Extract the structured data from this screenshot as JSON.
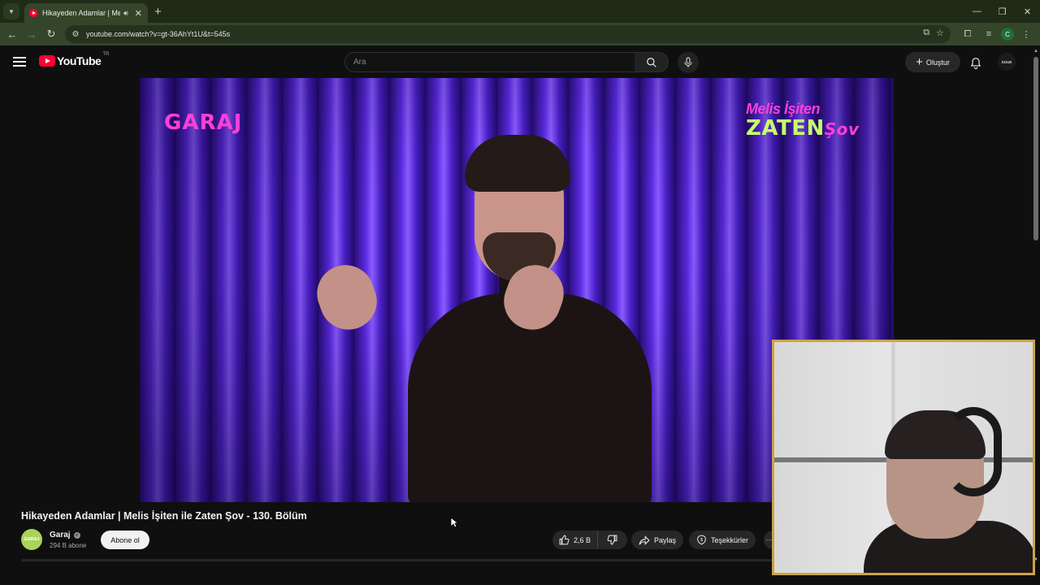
{
  "browser": {
    "tab_title": "Hikayeden Adamlar | Melis İşiten ile Zaten Şov",
    "tab_audio_icon": "speaker-icon",
    "url": "youtube.com/watch?v=gt-36AhYt1U&t=545s",
    "profile_initial": "C",
    "window_controls": {
      "minimize": "—",
      "restore": "❐",
      "close": "✕"
    }
  },
  "youtube": {
    "logo_text": "YouTube",
    "country_code": "TR",
    "search_placeholder": "Ara",
    "create_label": "Oluştur",
    "avatar_text": "SOUE"
  },
  "video": {
    "overlay_left_logo": "GARAJ",
    "overlay_right_line1": "Melis İşiten",
    "overlay_right_line2": "ZATEN",
    "overlay_right_line3": "Şov"
  },
  "info": {
    "title": "Hikayeden Adamlar | Melis İşiten ile Zaten Şov - 130. Bölüm",
    "channel_avatar_text": "GARAJ",
    "channel_name": "Garaj",
    "subscribers": "294 B abone",
    "subscribe_label": "Abone ol",
    "likes": "2,6 B",
    "share_label": "Paylaş",
    "thanks_label": "Teşekkürler"
  },
  "colors": {
    "yt_red": "#ff0033",
    "browser_frame": "#35452a",
    "webcam_border": "#caa34a",
    "overlay_pink": "#ff3fd8",
    "overlay_green": "#c6ff6a"
  }
}
